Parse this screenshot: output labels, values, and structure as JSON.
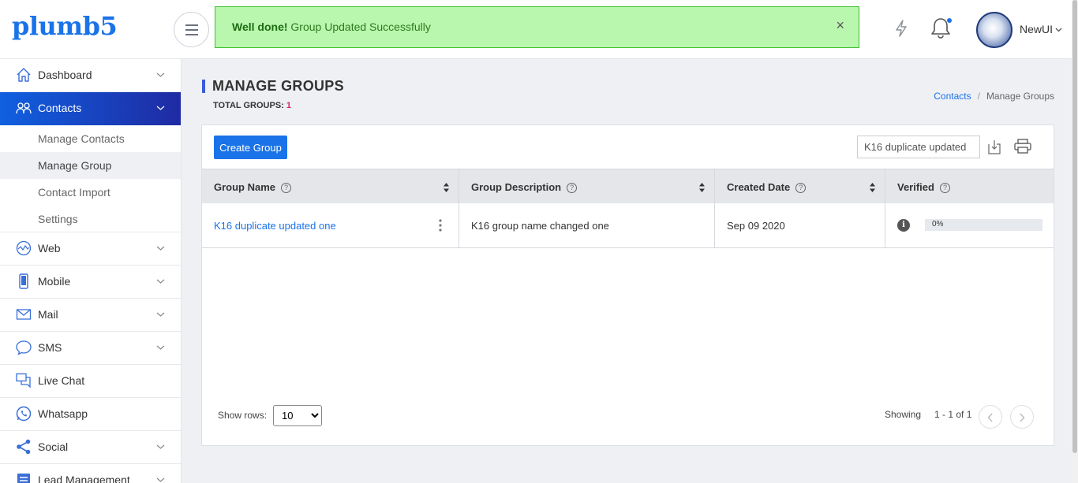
{
  "brand": {
    "logo_text": "plumb5"
  },
  "alert": {
    "strong": "Well done!",
    "message": " Group Updated Successfully",
    "close": "×"
  },
  "user": {
    "name": "NewUI"
  },
  "sidebar": {
    "items": [
      {
        "label": "Dashboard",
        "icon": "home-icon",
        "has_chevron": true
      },
      {
        "label": "Contacts",
        "icon": "contacts-icon",
        "has_chevron": true,
        "active": true
      },
      {
        "label": "Web",
        "icon": "web-icon",
        "has_chevron": true
      },
      {
        "label": "Mobile",
        "icon": "mobile-icon",
        "has_chevron": true
      },
      {
        "label": "Mail",
        "icon": "mail-icon",
        "has_chevron": true
      },
      {
        "label": "SMS",
        "icon": "sms-icon",
        "has_chevron": true
      },
      {
        "label": "Live Chat",
        "icon": "live-chat-icon",
        "has_chevron": false
      },
      {
        "label": "Whatsapp",
        "icon": "whatsapp-icon",
        "has_chevron": false
      },
      {
        "label": "Social",
        "icon": "social-icon",
        "has_chevron": true
      },
      {
        "label": "Lead Management",
        "icon": "lead-management-icon",
        "has_chevron": true
      }
    ],
    "contacts_sub": [
      "Manage Contacts",
      "Manage Group",
      "Contact Import",
      "Settings"
    ],
    "current_sub": "Manage Group"
  },
  "page": {
    "title": "MANAGE GROUPS",
    "total_label": "TOTAL GROUPS: ",
    "total_count": "1",
    "breadcrumb": {
      "link": "Contacts",
      "separator": "/",
      "current": "Manage Groups"
    }
  },
  "toolbar": {
    "create_label": "Create Group",
    "search_value": "K16 duplicate updated"
  },
  "table": {
    "headers": [
      "Group Name",
      "Group Description",
      "Created Date",
      "Verified"
    ],
    "help_glyph": "?",
    "rows": [
      {
        "name": "K16 duplicate updated one",
        "description": "K16 group name changed one",
        "created": "Sep 09 2020",
        "info_glyph": "i",
        "verified_label": "0%",
        "verified_percent": 0
      }
    ]
  },
  "pagination": {
    "show_rows_label": "Show rows:",
    "rows_value": "10",
    "rows_options": [
      "10"
    ],
    "showing_label": "Showing",
    "range": "1 - 1 of 1"
  },
  "colors": {
    "accent": "#1a73e8",
    "active_nav_start": "#1060e0",
    "active_nav_end": "#1f2aa3",
    "alert_bg": "#b8f7ad",
    "total_count": "#e0245e"
  }
}
